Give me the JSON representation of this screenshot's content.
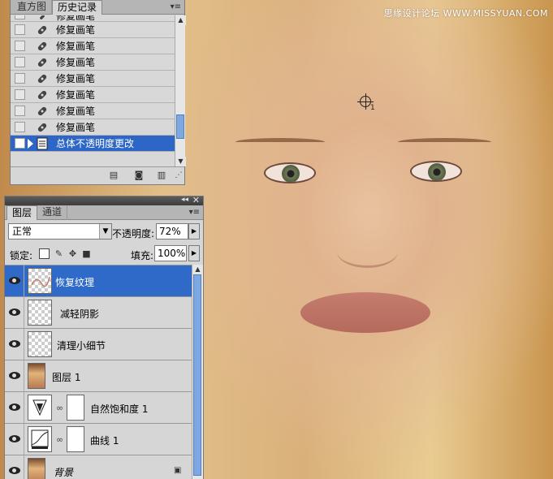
{
  "watermark": "思缘设计论坛  WWW.MISSYUAN.COM",
  "canvas": {
    "cursor_label": "1"
  },
  "history_panel": {
    "tabs": [
      "直方图",
      "历史记录"
    ],
    "active_tab": 1,
    "partial_first_item": "修复画笔",
    "items": [
      "修复画笔",
      "修复画笔",
      "修复画笔",
      "修复画笔",
      "修复画笔",
      "修复画笔",
      "修复画笔"
    ],
    "selected_item": "总体不透明度更改",
    "footer_icons": [
      "new-document-icon",
      "snapshot-camera-icon",
      "trash-icon"
    ]
  },
  "layers_panel": {
    "tabs": [
      "图层",
      "通道"
    ],
    "active_tab": 0,
    "blend_mode": "正常",
    "opacity_label": "不透明度:",
    "opacity_value": "72%",
    "lock_label": "锁定:",
    "fill_label": "填充:",
    "fill_value": "100%",
    "layers": [
      {
        "name": "恢复纹理",
        "selected": true,
        "thumb": "transparent-with-strokes"
      },
      {
        "name": "减轻阴影",
        "selected": false,
        "thumb": "transparent"
      },
      {
        "name": "清理小细节",
        "selected": false,
        "thumb": "transparent"
      },
      {
        "name": "图层 1",
        "selected": false,
        "thumb": "photo"
      },
      {
        "name": "自然饱和度 1",
        "selected": false,
        "thumb": "vibrance-adjustment"
      },
      {
        "name": "曲线 1",
        "selected": false,
        "thumb": "curves-adjustment"
      },
      {
        "name": "背景",
        "selected": false,
        "thumb": "photo",
        "locked": true
      }
    ]
  },
  "colors": {
    "selection_blue": "#2f6ac8",
    "panel_bg": "#d6d6d6",
    "title_bar": "#4a4a4a"
  }
}
